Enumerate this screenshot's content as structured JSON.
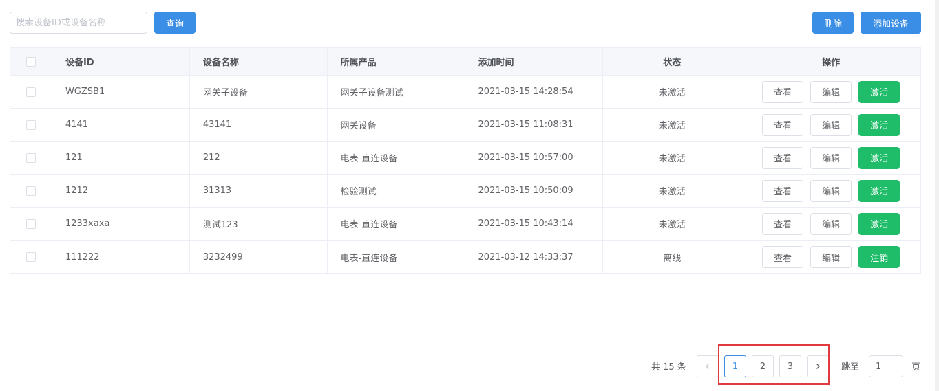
{
  "toolbar": {
    "search_placeholder": "搜索设备ID或设备名称",
    "search_value": "",
    "query_label": "查询",
    "delete_label": "删除",
    "add_label": "添加设备"
  },
  "table": {
    "headers": {
      "id": "设备ID",
      "name": "设备名称",
      "product": "所属产品",
      "time": "添加时间",
      "status": "状态",
      "ops": "操作"
    },
    "rows": [
      {
        "id": "WGZSB1",
        "name": "网关子设备",
        "product": "网关子设备测试",
        "time": "2021-03-15 14:28:54",
        "status": "未激活",
        "view": "查看",
        "edit": "编辑",
        "action": "激活"
      },
      {
        "id": "4141",
        "name": "43141",
        "product": "网关设备",
        "time": "2021-03-15 11:08:31",
        "status": "未激活",
        "view": "查看",
        "edit": "编辑",
        "action": "激活"
      },
      {
        "id": "121",
        "name": "212",
        "product": "电表-直连设备",
        "time": "2021-03-15 10:57:00",
        "status": "未激活",
        "view": "查看",
        "edit": "编辑",
        "action": "激活"
      },
      {
        "id": "1212",
        "name": "31313",
        "product": "检验测试",
        "time": "2021-03-15 10:50:09",
        "status": "未激活",
        "view": "查看",
        "edit": "编辑",
        "action": "激活"
      },
      {
        "id": "1233xaxa",
        "name": "测试123",
        "product": "电表-直连设备",
        "time": "2021-03-15 10:43:14",
        "status": "未激活",
        "view": "查看",
        "edit": "编辑",
        "action": "激活"
      },
      {
        "id": "111222",
        "name": "3232499",
        "product": "电表-直连设备",
        "time": "2021-03-12 14:33:37",
        "status": "离线",
        "view": "查看",
        "edit": "编辑",
        "action": "注销"
      }
    ]
  },
  "pagination": {
    "total_text": "共 15 条",
    "prev_icon": "chevron-left-icon",
    "pages": [
      "1",
      "2",
      "3"
    ],
    "current_page": "1",
    "next_icon": "chevron-right-icon",
    "jump_label": "跳至",
    "jump_value": "1",
    "page_unit": "页"
  },
  "colors": {
    "primary": "#3a8ee6",
    "success": "#1fbd6a",
    "highlight": "#e0393e"
  }
}
